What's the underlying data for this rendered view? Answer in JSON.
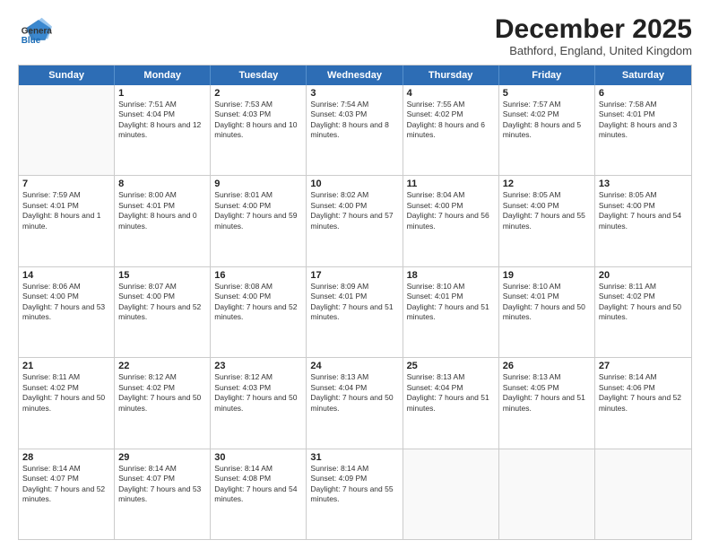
{
  "header": {
    "logo_line1": "General",
    "logo_line2": "Blue",
    "month_title": "December 2025",
    "location": "Bathford, England, United Kingdom"
  },
  "days_of_week": [
    "Sunday",
    "Monday",
    "Tuesday",
    "Wednesday",
    "Thursday",
    "Friday",
    "Saturday"
  ],
  "weeks": [
    [
      {
        "day": "",
        "sunrise": "",
        "sunset": "",
        "daylight": ""
      },
      {
        "day": "1",
        "sunrise": "Sunrise: 7:51 AM",
        "sunset": "Sunset: 4:04 PM",
        "daylight": "Daylight: 8 hours and 12 minutes."
      },
      {
        "day": "2",
        "sunrise": "Sunrise: 7:53 AM",
        "sunset": "Sunset: 4:03 PM",
        "daylight": "Daylight: 8 hours and 10 minutes."
      },
      {
        "day": "3",
        "sunrise": "Sunrise: 7:54 AM",
        "sunset": "Sunset: 4:03 PM",
        "daylight": "Daylight: 8 hours and 8 minutes."
      },
      {
        "day": "4",
        "sunrise": "Sunrise: 7:55 AM",
        "sunset": "Sunset: 4:02 PM",
        "daylight": "Daylight: 8 hours and 6 minutes."
      },
      {
        "day": "5",
        "sunrise": "Sunrise: 7:57 AM",
        "sunset": "Sunset: 4:02 PM",
        "daylight": "Daylight: 8 hours and 5 minutes."
      },
      {
        "day": "6",
        "sunrise": "Sunrise: 7:58 AM",
        "sunset": "Sunset: 4:01 PM",
        "daylight": "Daylight: 8 hours and 3 minutes."
      }
    ],
    [
      {
        "day": "7",
        "sunrise": "Sunrise: 7:59 AM",
        "sunset": "Sunset: 4:01 PM",
        "daylight": "Daylight: 8 hours and 1 minute."
      },
      {
        "day": "8",
        "sunrise": "Sunrise: 8:00 AM",
        "sunset": "Sunset: 4:01 PM",
        "daylight": "Daylight: 8 hours and 0 minutes."
      },
      {
        "day": "9",
        "sunrise": "Sunrise: 8:01 AM",
        "sunset": "Sunset: 4:00 PM",
        "daylight": "Daylight: 7 hours and 59 minutes."
      },
      {
        "day": "10",
        "sunrise": "Sunrise: 8:02 AM",
        "sunset": "Sunset: 4:00 PM",
        "daylight": "Daylight: 7 hours and 57 minutes."
      },
      {
        "day": "11",
        "sunrise": "Sunrise: 8:04 AM",
        "sunset": "Sunset: 4:00 PM",
        "daylight": "Daylight: 7 hours and 56 minutes."
      },
      {
        "day": "12",
        "sunrise": "Sunrise: 8:05 AM",
        "sunset": "Sunset: 4:00 PM",
        "daylight": "Daylight: 7 hours and 55 minutes."
      },
      {
        "day": "13",
        "sunrise": "Sunrise: 8:05 AM",
        "sunset": "Sunset: 4:00 PM",
        "daylight": "Daylight: 7 hours and 54 minutes."
      }
    ],
    [
      {
        "day": "14",
        "sunrise": "Sunrise: 8:06 AM",
        "sunset": "Sunset: 4:00 PM",
        "daylight": "Daylight: 7 hours and 53 minutes."
      },
      {
        "day": "15",
        "sunrise": "Sunrise: 8:07 AM",
        "sunset": "Sunset: 4:00 PM",
        "daylight": "Daylight: 7 hours and 52 minutes."
      },
      {
        "day": "16",
        "sunrise": "Sunrise: 8:08 AM",
        "sunset": "Sunset: 4:00 PM",
        "daylight": "Daylight: 7 hours and 52 minutes."
      },
      {
        "day": "17",
        "sunrise": "Sunrise: 8:09 AM",
        "sunset": "Sunset: 4:01 PM",
        "daylight": "Daylight: 7 hours and 51 minutes."
      },
      {
        "day": "18",
        "sunrise": "Sunrise: 8:10 AM",
        "sunset": "Sunset: 4:01 PM",
        "daylight": "Daylight: 7 hours and 51 minutes."
      },
      {
        "day": "19",
        "sunrise": "Sunrise: 8:10 AM",
        "sunset": "Sunset: 4:01 PM",
        "daylight": "Daylight: 7 hours and 50 minutes."
      },
      {
        "day": "20",
        "sunrise": "Sunrise: 8:11 AM",
        "sunset": "Sunset: 4:02 PM",
        "daylight": "Daylight: 7 hours and 50 minutes."
      }
    ],
    [
      {
        "day": "21",
        "sunrise": "Sunrise: 8:11 AM",
        "sunset": "Sunset: 4:02 PM",
        "daylight": "Daylight: 7 hours and 50 minutes."
      },
      {
        "day": "22",
        "sunrise": "Sunrise: 8:12 AM",
        "sunset": "Sunset: 4:02 PM",
        "daylight": "Daylight: 7 hours and 50 minutes."
      },
      {
        "day": "23",
        "sunrise": "Sunrise: 8:12 AM",
        "sunset": "Sunset: 4:03 PM",
        "daylight": "Daylight: 7 hours and 50 minutes."
      },
      {
        "day": "24",
        "sunrise": "Sunrise: 8:13 AM",
        "sunset": "Sunset: 4:04 PM",
        "daylight": "Daylight: 7 hours and 50 minutes."
      },
      {
        "day": "25",
        "sunrise": "Sunrise: 8:13 AM",
        "sunset": "Sunset: 4:04 PM",
        "daylight": "Daylight: 7 hours and 51 minutes."
      },
      {
        "day": "26",
        "sunrise": "Sunrise: 8:13 AM",
        "sunset": "Sunset: 4:05 PM",
        "daylight": "Daylight: 7 hours and 51 minutes."
      },
      {
        "day": "27",
        "sunrise": "Sunrise: 8:14 AM",
        "sunset": "Sunset: 4:06 PM",
        "daylight": "Daylight: 7 hours and 52 minutes."
      }
    ],
    [
      {
        "day": "28",
        "sunrise": "Sunrise: 8:14 AM",
        "sunset": "Sunset: 4:07 PM",
        "daylight": "Daylight: 7 hours and 52 minutes."
      },
      {
        "day": "29",
        "sunrise": "Sunrise: 8:14 AM",
        "sunset": "Sunset: 4:07 PM",
        "daylight": "Daylight: 7 hours and 53 minutes."
      },
      {
        "day": "30",
        "sunrise": "Sunrise: 8:14 AM",
        "sunset": "Sunset: 4:08 PM",
        "daylight": "Daylight: 7 hours and 54 minutes."
      },
      {
        "day": "31",
        "sunrise": "Sunrise: 8:14 AM",
        "sunset": "Sunset: 4:09 PM",
        "daylight": "Daylight: 7 hours and 55 minutes."
      },
      {
        "day": "",
        "sunrise": "",
        "sunset": "",
        "daylight": ""
      },
      {
        "day": "",
        "sunrise": "",
        "sunset": "",
        "daylight": ""
      },
      {
        "day": "",
        "sunrise": "",
        "sunset": "",
        "daylight": ""
      }
    ]
  ]
}
